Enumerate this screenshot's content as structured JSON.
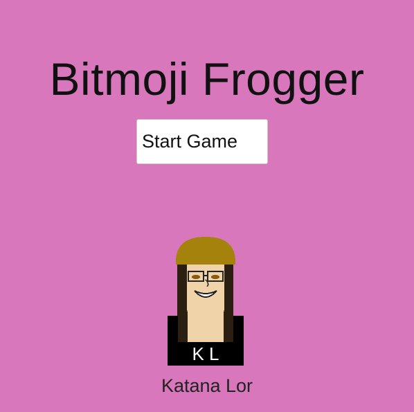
{
  "game": {
    "title": "Bitmoji Frogger",
    "start_button_label": "Start Game",
    "creator_name": "Katana Lor",
    "shirt_initials": "K L"
  },
  "colors": {
    "background": "#d877bc",
    "button": "#ffffff",
    "hair_top": "#a5820c",
    "hair_long": "#2b1f12",
    "skin": "#f0d3a8",
    "shirt": "#000000"
  },
  "icons": {
    "avatar": "bitmoji-avatar-icon"
  }
}
